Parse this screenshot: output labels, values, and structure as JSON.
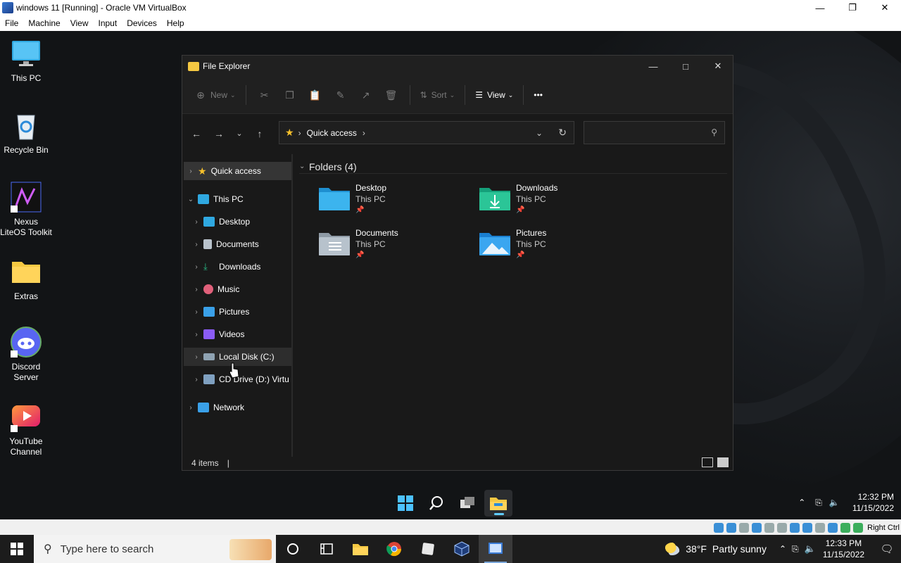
{
  "vbox": {
    "title": "windows 11 [Running] - Oracle VM VirtualBox",
    "menu": [
      "File",
      "Machine",
      "View",
      "Input",
      "Devices",
      "Help"
    ],
    "status_right": "Right Ctrl"
  },
  "desktop_icons": [
    {
      "label": "This PC",
      "icon": "monitor-icon"
    },
    {
      "label": "Recycle Bin",
      "icon": "recycle-bin-icon"
    },
    {
      "label": "Nexus LiteOS Toolkit",
      "icon": "nexus-toolkit-icon"
    },
    {
      "label": "Extras",
      "icon": "folder-icon"
    },
    {
      "label": "Discord Server",
      "icon": "discord-icon"
    },
    {
      "label": "YouTube Channel",
      "icon": "youtube-icon"
    }
  ],
  "explorer": {
    "title": "File Explorer",
    "toolbar": {
      "new_label": "New",
      "sort_label": "Sort",
      "view_label": "View",
      "more_label": "•••"
    },
    "address": {
      "crumb": "Quick access",
      "search_placeholder": ""
    },
    "nav": [
      {
        "label": "Quick access",
        "icon": "star-icon"
      },
      {
        "label": "This PC",
        "icon": "this-pc-icon"
      },
      {
        "label": "Desktop",
        "icon": "desktop-folder-icon"
      },
      {
        "label": "Documents",
        "icon": "documents-icon"
      },
      {
        "label": "Downloads",
        "icon": "downloads-icon"
      },
      {
        "label": "Music",
        "icon": "music-icon"
      },
      {
        "label": "Pictures",
        "icon": "pictures-icon"
      },
      {
        "label": "Videos",
        "icon": "videos-icon"
      },
      {
        "label": "Local Disk (C:)",
        "icon": "drive-icon"
      },
      {
        "label": "CD Drive (D:) Virtu",
        "icon": "cd-drive-icon"
      },
      {
        "label": "Network",
        "icon": "network-icon"
      }
    ],
    "group_header": "Folders (4)",
    "folders": [
      {
        "name": "Desktop",
        "location": "This PC",
        "icon": "desktop-folder-icon"
      },
      {
        "name": "Downloads",
        "location": "This PC",
        "icon": "downloads-folder-icon"
      },
      {
        "name": "Documents",
        "location": "This PC",
        "icon": "documents-folder-icon"
      },
      {
        "name": "Pictures",
        "location": "This PC",
        "icon": "pictures-folder-icon"
      }
    ],
    "status_text": "4 items",
    "status_sep": "|"
  },
  "guest_taskbar": {
    "time": "12:32 PM",
    "date": "11/15/2022"
  },
  "host_taskbar": {
    "search_placeholder": "Type here to search",
    "weather_temp": "38°F",
    "weather_desc": "Partly sunny",
    "time": "12:33 PM",
    "date": "11/15/2022"
  },
  "colors": {
    "accent": "#60cdff",
    "folder_yellow": "#f5c842",
    "star": "#f7c12b"
  }
}
